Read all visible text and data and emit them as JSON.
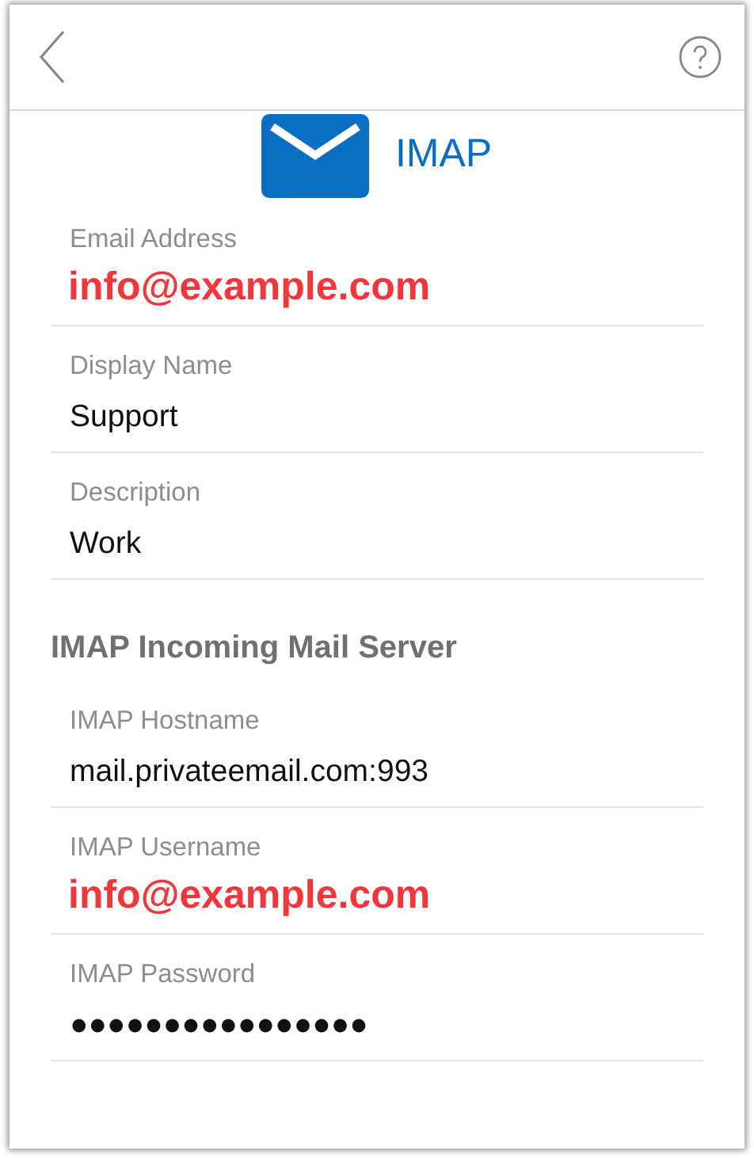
{
  "header": {
    "title": "IMAP"
  },
  "sections": [
    {
      "fields": [
        {
          "label": "Email Address",
          "value": "info@example.com",
          "kind": "annotated"
        },
        {
          "label": "Display Name",
          "value": "Support",
          "kind": "plain"
        },
        {
          "label": "Description",
          "value": "Work",
          "kind": "plain"
        }
      ]
    },
    {
      "heading": "IMAP Incoming Mail Server",
      "fields": [
        {
          "label": "IMAP Hostname",
          "value": "mail.privateemail.com:993",
          "kind": "plain"
        },
        {
          "label": "IMAP Username",
          "value": "info@example.com",
          "kind": "annotated"
        },
        {
          "label": "IMAP Password",
          "value": "●●●●●●●●●●●●●●●●",
          "kind": "plain"
        }
      ]
    }
  ]
}
